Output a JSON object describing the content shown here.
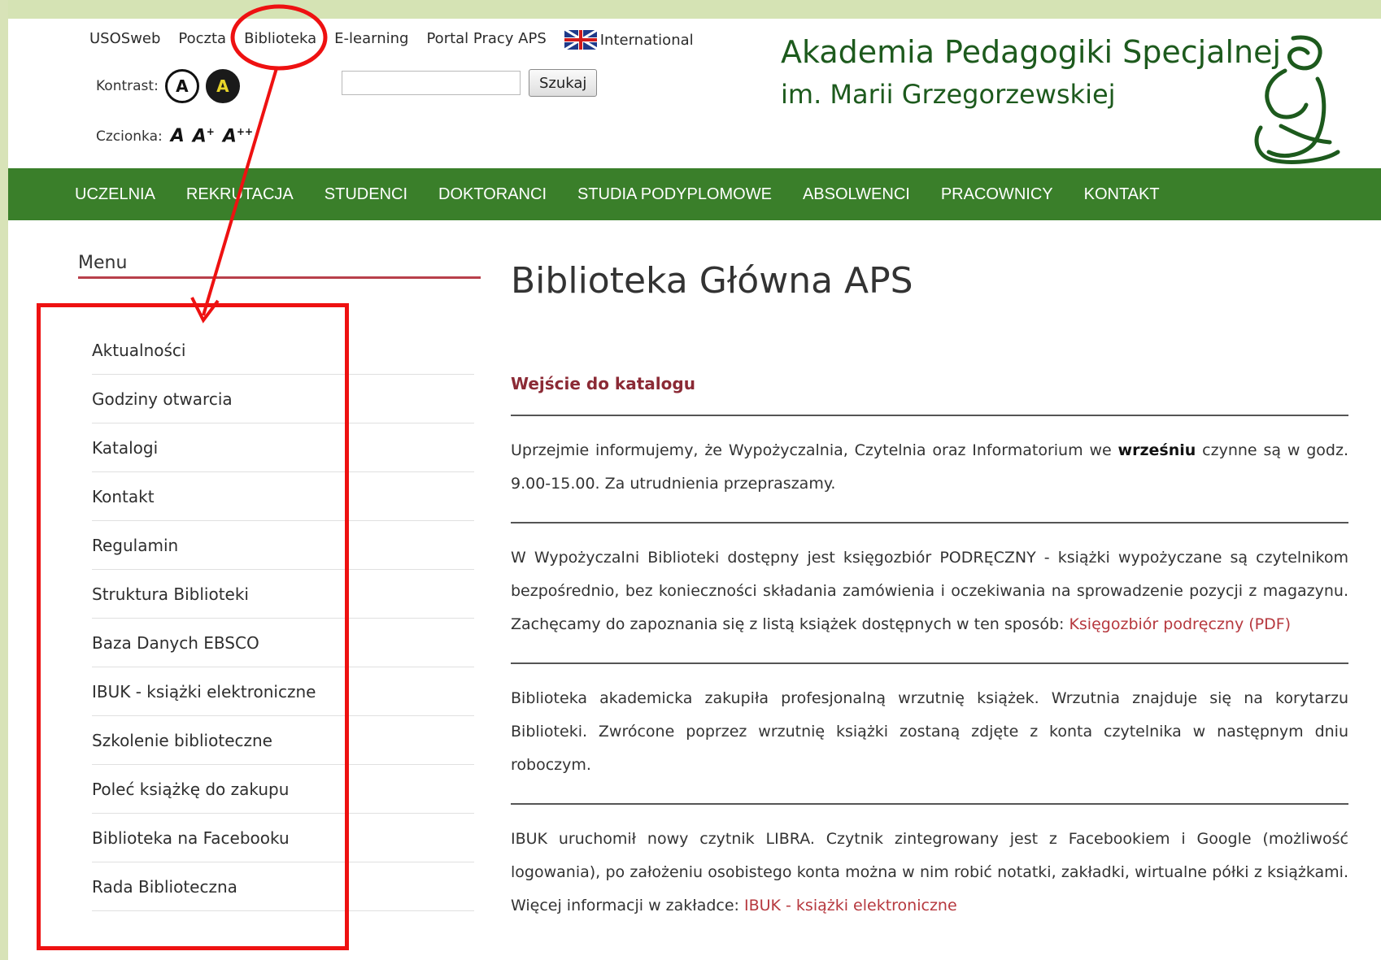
{
  "header": {
    "links": [
      "USOSweb",
      "Poczta",
      "Biblioteka",
      "E-learning",
      "Portal Pracy APS",
      "International"
    ],
    "contrast_label": "Kontrast:",
    "contrast_light": "A",
    "contrast_dark": "A",
    "font_label": "Czcionka:",
    "font_a": "A",
    "font_a_plus": "A",
    "font_plus": "+",
    "font_a_plusplus": "A",
    "font_plusplus": "++",
    "search_button": "Szukaj",
    "search_value": "",
    "brand_line1": "Akademia Pedagogiki Specjalnej",
    "brand_line2": "im. Marii Grzegorzewskiej"
  },
  "nav": [
    "UCZELNIA",
    "REKRUTACJA",
    "STUDENCI",
    "DOKTORANCI",
    "STUDIA PODYPLOMOWE",
    "ABSOLWENCI",
    "PRACOWNICY",
    "KONTAKT"
  ],
  "sidebar": {
    "title": "Menu",
    "items": [
      "Aktualności",
      "Godziny otwarcia",
      "Katalogi",
      "Kontakt",
      "Regulamin",
      "Struktura Biblioteki",
      "Baza Danych EBSCO",
      "IBUK - książki elektroniczne",
      "Szkolenie biblioteczne",
      "Poleć książkę do zakupu",
      "Biblioteka na Facebooku",
      "Rada Biblioteczna"
    ]
  },
  "main": {
    "title": "Biblioteka Główna APS",
    "catalog_link": "Wejście do katalogu",
    "p1_a": "Uprzejmie informujemy, że Wypożyczalnia, Czytelnia oraz Informatorium we ",
    "p1_b": "wrześniu",
    "p1_c": " czynne są w godz. 9.00-15.00. Za utrudnienia przepraszamy.",
    "p2_text": "W Wypożyczalni Biblioteki dostępny jest księgozbiór PODRĘCZNY - książki wypożyczane są czytelnikom bezpośrednio, bez konieczności składania zamówienia i oczekiwania na sprowadzenie pozycji z magazynu. Zachęcamy do zapoznania się z listą książek dostępnych w ten sposób: ",
    "p2_link": "Księgozbiór podręczny (PDF)",
    "p3": "Biblioteka akademicka zakupiła profesjonalną wrzutnię książek. Wrzutnia znajduje się na korytarzu Biblioteki. Zwrócone poprzez wrzutnię książki zostaną zdjęte z konta czytelnika w następnym dniu roboczym.",
    "p4_text": "IBUK uruchomił nowy czytnik LIBRA. Czytnik zintegrowany jest z Facebookiem i Google (możliwość logowania), po założeniu osobistego konta można w nim robić notatki, zakładki, wirtualne półki z książkami. Więcej informacji w zakładce: ",
    "p4_link": "IBUK - książki elektroniczne"
  },
  "colors": {
    "nav_bg": "#3a7f2a",
    "brand": "#1d5a1d",
    "accent_red": "#b8404b",
    "annotation": "#ee1111"
  }
}
